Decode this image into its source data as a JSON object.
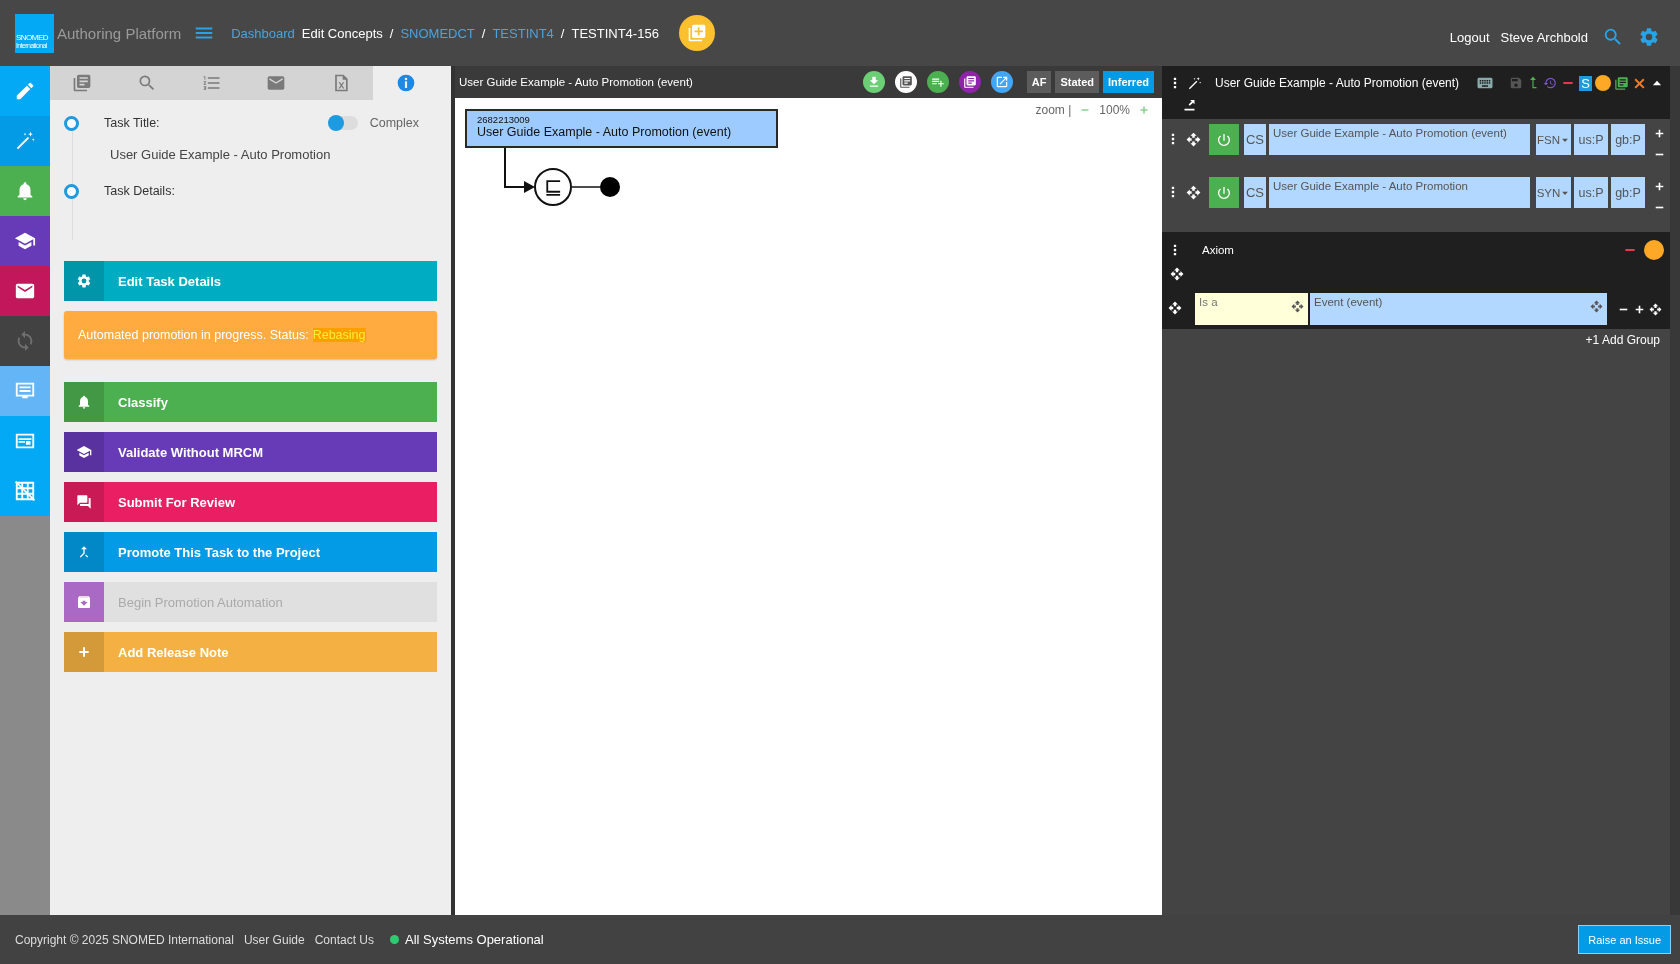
{
  "header": {
    "logo": {
      "text": "SNOMED",
      "subtext": "International"
    },
    "app_name": "Authoring Platform",
    "breadcrumbs": [
      {
        "label": "Dashboard",
        "kind": "link"
      },
      {
        "label": "Edit Concepts",
        "kind": "plain"
      },
      {
        "label": "/",
        "kind": "separator"
      },
      {
        "label": "SNOMEDCT",
        "kind": "link"
      },
      {
        "label": "/",
        "kind": "separator"
      },
      {
        "label": "TESTINT4",
        "kind": "link"
      },
      {
        "label": "/",
        "kind": "separator"
      },
      {
        "label": "TESTINT4-156",
        "kind": "current"
      }
    ],
    "user_links": [
      "Logout",
      "Steve Archbold"
    ]
  },
  "nav_rail": [
    {
      "color": "#03a9f4",
      "disabled": false
    },
    {
      "color": "#039be5",
      "disabled": false
    },
    {
      "color": "#4caf50",
      "disabled": false
    },
    {
      "color": "#673ab7",
      "disabled": false
    },
    {
      "color": "#c2185b",
      "disabled": false
    },
    {
      "color": "#424242",
      "disabled": true
    },
    {
      "color": "#64b5f6",
      "disabled": false
    },
    {
      "color": "#03a9f4",
      "disabled": false
    },
    {
      "color": "#03a9f4",
      "disabled": false
    }
  ],
  "tabs": [
    {
      "selected": false
    },
    {
      "selected": false
    },
    {
      "selected": false
    },
    {
      "selected": false
    },
    {
      "selected": false
    },
    {
      "selected": true
    }
  ],
  "task": {
    "title_label": "Task Title:",
    "complex_toggle": {
      "label": "Complex",
      "on": false
    },
    "title_value": "User Guide Example - Auto Promotion",
    "details_label": "Task Details:"
  },
  "actions": [
    {
      "kind": "button",
      "label": "Edit Task Details",
      "color": "#00acc1",
      "disabled": false
    },
    {
      "kind": "status",
      "text": "Automated promotion in progress. Status:",
      "status": "Rebasing",
      "color": "#ffab40"
    },
    {
      "kind": "button",
      "label": "Classify",
      "color": "#4caf50",
      "disabled": false
    },
    {
      "kind": "button",
      "label": "Validate Without MRCM",
      "color": "#673ab7",
      "disabled": false
    },
    {
      "kind": "button",
      "label": "Submit For Review",
      "color": "#e91e63",
      "disabled": false
    },
    {
      "kind": "button",
      "label": "Promote This Task to the Project",
      "color": "#039be5",
      "disabled": false
    },
    {
      "kind": "button",
      "label": "Begin Promotion Automation",
      "color": "#ab69c6",
      "disabled": true
    },
    {
      "kind": "button",
      "label": "Add Release Note",
      "color": "#f4b042",
      "disabled": false
    }
  ],
  "diagram": {
    "title": "User Guide Example - Auto Promotion (event)",
    "view_modes": [
      {
        "label": "AF",
        "selected": false
      },
      {
        "label": "Stated",
        "selected": false
      },
      {
        "label": "Inferred",
        "selected": true
      }
    ],
    "zoom": {
      "label": "zoom |",
      "value": "100%"
    },
    "concept": {
      "id": "2682213009",
      "term": "User Guide Example - Auto Promotion (event)"
    },
    "relation_symbol": "⊑"
  },
  "concept_panel": {
    "title": "User Guide Example - Auto Promotion (event)",
    "badge": "S",
    "descriptions": [
      {
        "active": true,
        "case": "CS",
        "term": "User Guide Example - Auto Promotion (event)",
        "type": "FSN",
        "acceptability": [
          "us:P",
          "gb:P"
        ]
      },
      {
        "active": true,
        "case": "CS",
        "term": "User Guide Example - Auto Promotion",
        "type": "SYN",
        "acceptability": [
          "us:P",
          "gb:P"
        ]
      }
    ],
    "axiom": {
      "label": "Axiom",
      "relationships": [
        {
          "type": "Is a",
          "target": "Event (event)"
        }
      ]
    },
    "add_group": "+1 Add Group"
  },
  "footer": {
    "copyright": "Copyright © 2025 SNOMED International",
    "links": [
      "User Guide",
      "Contact Us"
    ],
    "status": "All Systems Operational",
    "raise_button": "Raise an Issue"
  }
}
